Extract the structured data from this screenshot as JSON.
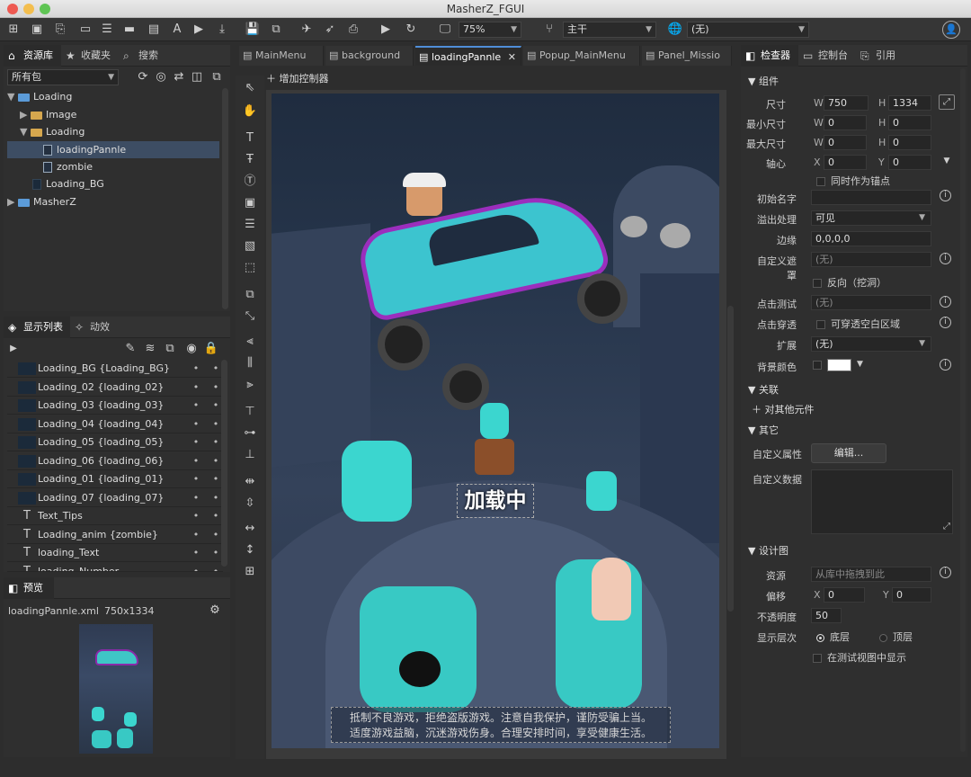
{
  "window": {
    "title": "MasherZ_FGUI"
  },
  "toolbar": {
    "zoom": "75%",
    "branch": "主干",
    "language": "(无)"
  },
  "library": {
    "tabs": [
      "资源库",
      "收藏夹",
      "搜索"
    ],
    "package_filter": "所有包",
    "tree": [
      {
        "label": "Loading",
        "level": 0,
        "type": "package",
        "expanded": true
      },
      {
        "label": "Image",
        "level": 1,
        "type": "folder",
        "expanded": false
      },
      {
        "label": "Loading",
        "level": 1,
        "type": "folder",
        "expanded": true
      },
      {
        "label": "loadingPannle",
        "level": 2,
        "type": "component",
        "selected": true
      },
      {
        "label": "zombie",
        "level": 2,
        "type": "movieclip"
      },
      {
        "label": "Loading_BG",
        "level": 1,
        "type": "image"
      },
      {
        "label": "MasherZ",
        "level": 0,
        "type": "package",
        "expanded": false
      }
    ]
  },
  "display_list": {
    "tabs": [
      "显示列表",
      "动效"
    ],
    "items": [
      "Loading_BG {Loading_BG}",
      "Loading_02 {loading_02}",
      "Loading_03 {loading_03}",
      "Loading_04 {loading_04}",
      "Loading_05 {loading_05}",
      "Loading_06 {loading_06}",
      "Loading_01 {loading_01}",
      "Loading_07 {loading_07}",
      "Text_Tips",
      "Loading_anim {zombie}",
      "loading_Text",
      "loading_Number"
    ],
    "dot": "•"
  },
  "preview": {
    "tab": "预览",
    "file": "loadingPannle.xml",
    "size": "750x1334"
  },
  "editor": {
    "tabs": [
      "MainMenu",
      "background",
      "loadingPannle",
      "Popup_MainMenu",
      "Panel_Missio"
    ],
    "active_tab": "loadingPannle",
    "add_controller": "增加控制器",
    "loading_text": "加载中",
    "tips_line1": "抵制不良游戏，拒绝盗版游戏。注意自我保护，谨防受骗上当。",
    "tips_line2": "适度游戏益脑，沉迷游戏伤身。合理安排时间，享受健康生活。"
  },
  "inspector": {
    "tabs": [
      "检查器",
      "控制台",
      "引用"
    ],
    "section_component": "组件",
    "size_label": "尺寸",
    "w_label": "W",
    "h_label": "H",
    "width": "750",
    "height": "1334",
    "min_size_label": "最小尺寸",
    "min_w": "0",
    "min_h": "0",
    "max_size_label": "最大尺寸",
    "max_w": "0",
    "max_h": "0",
    "pivot_label": "轴心",
    "x_label": "X",
    "y_label": "Y",
    "pivot_x": "0",
    "pivot_y": "0",
    "anchor_label": "同时作为锚点",
    "init_name_label": "初始名字",
    "overflow_label": "溢出处理",
    "overflow_value": "可见",
    "margin_label": "边缘",
    "margin_value": "0,0,0,0",
    "mask_label": "自定义遮罩",
    "mask_value": "(无)",
    "reverse_label": "反向（挖洞）",
    "hit_test_label": "点击测试",
    "hit_test_value": "(无)",
    "click_through_label": "点击穿透",
    "click_through_value": "可穿透空白区域",
    "extend_label": "扩展",
    "extend_value": "(无)",
    "bg_color_label": "背景颜色",
    "section_relation": "关联",
    "relation_add": "对其他元件",
    "section_other": "其它",
    "custom_prop_label": "自定义属性",
    "edit_button": "编辑...",
    "custom_data_label": "自定义数据",
    "section_design": "设计图",
    "resource_label": "资源",
    "resource_placeholder": "从库中拖拽到此",
    "offset_label": "偏移",
    "offset_x": "0",
    "offset_y": "0",
    "opacity_label": "不透明度",
    "opacity_value": "50",
    "layer_label": "显示层次",
    "layer_bottom": "底层",
    "layer_top": "顶层",
    "show_in_test": "在测试视图中显示"
  },
  "colors": {
    "accent": "#4f8ed8",
    "selection": "#3d4d63",
    "background": "#2d2d2d"
  }
}
